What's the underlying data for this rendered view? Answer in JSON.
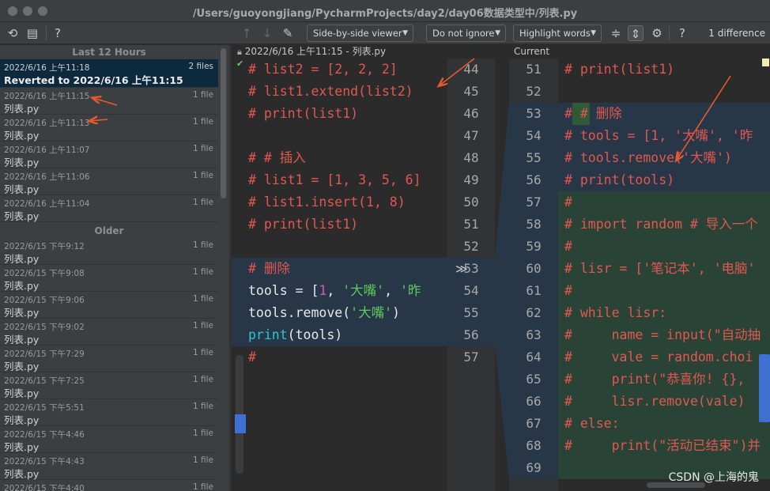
{
  "window": {
    "title": "/Users/guoyongjiang/PycharmProjects/day2/day06数据类型中/列表.py"
  },
  "toolbar": {
    "viewer_label": "Side-by-side viewer",
    "ignore_label": "Do not ignore",
    "highlight_label": "Highlight words",
    "help_glyph": "?",
    "difference_count": "1 difference"
  },
  "history": {
    "group_recent": "Last 12 Hours",
    "group_older": "Older",
    "recent_items": [
      {
        "date": "2022/6/16 上午11:18",
        "files": "2 files",
        "name": "Reverted to 2022/6/16 上午11:15",
        "selected": true
      },
      {
        "date": "2022/6/16 上午11:15",
        "files": "1 file",
        "name": "列表.py"
      },
      {
        "date": "2022/6/16 上午11:13",
        "files": "1 file",
        "name": "列表.py"
      },
      {
        "date": "2022/6/16 上午11:07",
        "files": "1 file",
        "name": "列表.py"
      },
      {
        "date": "2022/6/16 上午11:06",
        "files": "1 file",
        "name": "列表.py"
      },
      {
        "date": "2022/6/16 上午11:04",
        "files": "1 file",
        "name": "列表.py"
      }
    ],
    "older_items": [
      {
        "date": "2022/6/15 下午9:12",
        "files": "1 file",
        "name": "列表.py"
      },
      {
        "date": "2022/6/15 下午9:08",
        "files": "1 file",
        "name": "列表.py"
      },
      {
        "date": "2022/6/15 下午9:06",
        "files": "1 file",
        "name": "列表.py"
      },
      {
        "date": "2022/6/15 下午9:02",
        "files": "1 file",
        "name": "列表.py"
      },
      {
        "date": "2022/6/15 下午7:29",
        "files": "1 file",
        "name": "列表.py"
      },
      {
        "date": "2022/6/15 下午7:25",
        "files": "1 file",
        "name": "列表.py"
      },
      {
        "date": "2022/6/15 下午5:51",
        "files": "1 file",
        "name": "列表.py"
      },
      {
        "date": "2022/6/15 下午4:46",
        "files": "1 file",
        "name": "列表.py"
      },
      {
        "date": "2022/6/15 下午4:43",
        "files": "1 file",
        "name": "列表.py"
      },
      {
        "date": "2022/6/15 下午4:40",
        "files": "1 file",
        "name": "列表.py"
      }
    ]
  },
  "diff": {
    "left_header": "2022/6/16 上午11:15 - 列表.py",
    "right_header": "Current",
    "left_line_numbers": [
      "44",
      "45",
      "46",
      "47",
      "48",
      "49",
      "50",
      "51",
      "52",
      "53",
      "54",
      "55",
      "56",
      "57"
    ],
    "right_line_numbers": [
      "51",
      "52",
      "53",
      "54",
      "55",
      "56",
      "57",
      "58",
      "59",
      "60",
      "61",
      "62",
      "63",
      "64",
      "65",
      "66",
      "67",
      "68",
      "69"
    ],
    "left_lines": [
      "# list2 = [2, 2, 2]",
      "# list1.extend(list2)",
      "# print(list1)",
      "",
      "# # 插入",
      "# list1 = [1, 3, 5, 6]",
      "# list1.insert(1, 8)",
      "# print(list1)",
      "",
      "# 删除",
      "tools = [1, '大嘴', '昨",
      "tools.remove('大嘴')",
      "print(tools)",
      "#"
    ],
    "right_lines": [
      "# print(list1)",
      "",
      "# # 删除",
      "# tools = [1, '大嘴', '昨",
      "# tools.remove('大嘴')",
      "# print(tools)",
      "#",
      "# import random # 导入一个",
      "#",
      "# lisr = ['笔记本', '电脑'",
      "#",
      "# while lisr:",
      "#     name = input(\"自动抽",
      "#     vale = random.choi",
      "#     print(\"恭喜你! {},",
      "#     lisr.remove(vale)",
      "# else:",
      "#     print(\"活动已结束\")并",
      ""
    ],
    "left_tokens": {
      "tools_kw": "tools",
      "eq": " = ",
      "bracket": "[",
      "one": "1",
      "comma": ", ",
      "s1": "'大嘴'",
      "s2": "'昨",
      "remove": "tools.remove(",
      "remove_str": "'大嘴'",
      "remove_end": ")",
      "print_fn": "print",
      "print_rest": "(tools)"
    }
  },
  "watermark": "CSDN @上海的鬼",
  "colors": {
    "comment": "#e0584f",
    "string": "#5ec95e",
    "number": "#d35bb6",
    "function": "#29c6cf",
    "changed_bg": "#283748",
    "inserted_bg": "#294436",
    "annotation_arrow": "#e8592e"
  }
}
